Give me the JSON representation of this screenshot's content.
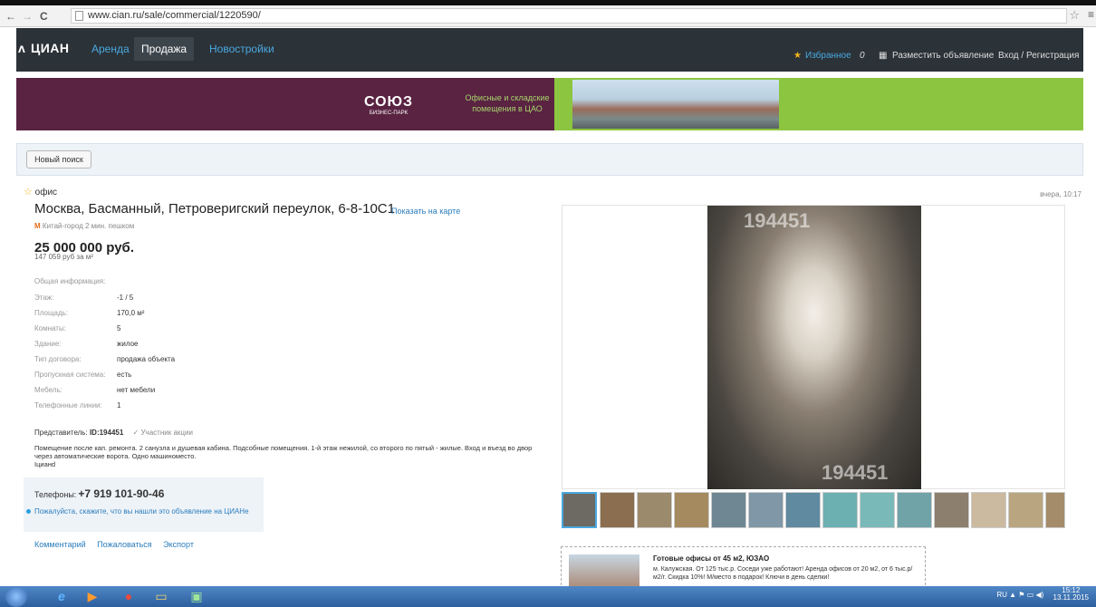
{
  "browser": {
    "url": "www.cian.ru/sale/commercial/1220590/",
    "back": "←",
    "forward": "→",
    "reload": "C"
  },
  "header": {
    "logo": "ЦИАН",
    "nav": [
      "Аренда",
      "Продажа",
      "Новостройки"
    ],
    "favorites": "Избранное",
    "favorites_count": "0",
    "post_ad": "Разместить объявление",
    "login": "Вход / Регистрация"
  },
  "banner": {
    "logo_main": "СОЮЗ",
    "logo_sub": "БИЗНЕС-ПАРК",
    "tagline": "Офисные и складские помещения в ЦАО"
  },
  "search": {
    "new_search": "Новый поиск"
  },
  "listing": {
    "type": "офис",
    "date": "вчера, 10:17",
    "address": "Москва, Басманный, Петроверигский переулок, 6-8-10С1",
    "show_map": "Показать на карте",
    "metro_letter": "М",
    "metro": "Китай-город 2 мин. пешком",
    "price": "25 000 000 руб.",
    "price_per_sqm": "147 059 руб за м²",
    "info_head": "Общая информация:",
    "info": [
      {
        "k": "Этаж:",
        "v": "-1 / 5"
      },
      {
        "k": "Площадь:",
        "v": "170,0 м²"
      },
      {
        "k": "Комнаты:",
        "v": "5"
      },
      {
        "k": "Здание:",
        "v": "жилое"
      },
      {
        "k": "Тип договора:",
        "v": "продажа объекта"
      },
      {
        "k": "Пропускная система:",
        "v": "есть"
      },
      {
        "k": "Мебель:",
        "v": "нет мебели"
      },
      {
        "k": "Телефонные линии:",
        "v": "1"
      }
    ],
    "agent_label": "Представитель:",
    "agent_id": "ID:194451",
    "agent_badge": "Участник акции",
    "description": "Помещение после кап. ремонта. 2 санузла и душевая кабина. Подсобные помещения. 1-й этаж нежилой, со второго по пятый - жилые. Вход и въезд во двор через автоматические ворота. Одно машиноместо.",
    "description_sign": "Iцианd",
    "phone_label": "Телефоны:",
    "phone": "+7 919 101-90-46",
    "phone_note": "Пожалуйста, скажите, что вы нашли это объявление на ЦИАНе",
    "links": [
      "Комментарий",
      "Пожаловаться",
      "Экспорт"
    ],
    "watermark": "194451"
  },
  "ad": {
    "title": "Готовые офисы от 45 м2, ЮЗАО",
    "text": "м. Калужская. От 125 тыс.р. Соседи уже работают! Аренда офисов от 20 м2, от 6 тыс.р/м2/г. Скидка 10%! М/место в подарок! Ключи в день сделки!"
  },
  "taskbar": {
    "lang": "RU",
    "time": "15:12",
    "date": "13.11.2015"
  },
  "colors": {
    "header_bg": "#2b3238",
    "link": "#2b7dbc",
    "banner_left": "#5a2342",
    "banner_right": "#8cc540"
  }
}
